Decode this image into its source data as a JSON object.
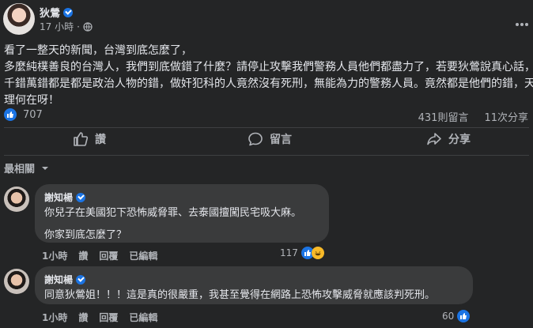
{
  "post": {
    "author": "狄鶯",
    "time": "17 小時",
    "lines": [
      "看了一整天的新聞，台灣到底怎麼了，",
      "多麼純樸善良的台灣人，我們到底做錯了什麼？請停止攻擊我們警務人員他們都盡力了，若要狄鶯說真心話，",
      "千錯萬錯都是都是政治人物的錯，做奸犯科的人竟然沒有死刑，無能為力的警務人員。竟然都是他們的錯，天",
      "理何在呀！"
    ],
    "reaction_count": "707",
    "comment_count": "431則留言",
    "share_count": "11次分享"
  },
  "actions": {
    "like": "讚",
    "comment": "留言",
    "share": "分享"
  },
  "sort_label": "最相關",
  "comments": [
    {
      "author": "謝知楊",
      "lines": [
        "你兒子在美國犯下恐怖威脅罪、去泰國擅闖民宅吸大麻。",
        "你家到底怎麼了？"
      ],
      "time": "1小時",
      "like": "讚",
      "reply": "回覆",
      "edited": "已編輯",
      "reaction_count": "117"
    },
    {
      "author": "謝知楊",
      "lines": [
        "同意狄鶯姐！！！這是真的很嚴重，我甚至覺得在網路上恐怖攻擊威脅就應該判死刑。"
      ],
      "time": "1小時",
      "like": "讚",
      "reply": "回覆",
      "edited": "已編輯",
      "reaction_count": "60"
    }
  ],
  "colors": {
    "background": "#242526",
    "bubble": "#3a3b3c",
    "accent": "#1b74e4",
    "text": "#e4e6eb",
    "muted": "#b0b3b8"
  },
  "icons": [
    "more-options-icon",
    "globe-icon",
    "like-icon",
    "comment-icon",
    "share-icon",
    "chevron-down-icon",
    "haha-reaction-icon",
    "verified-badge-icon"
  ]
}
